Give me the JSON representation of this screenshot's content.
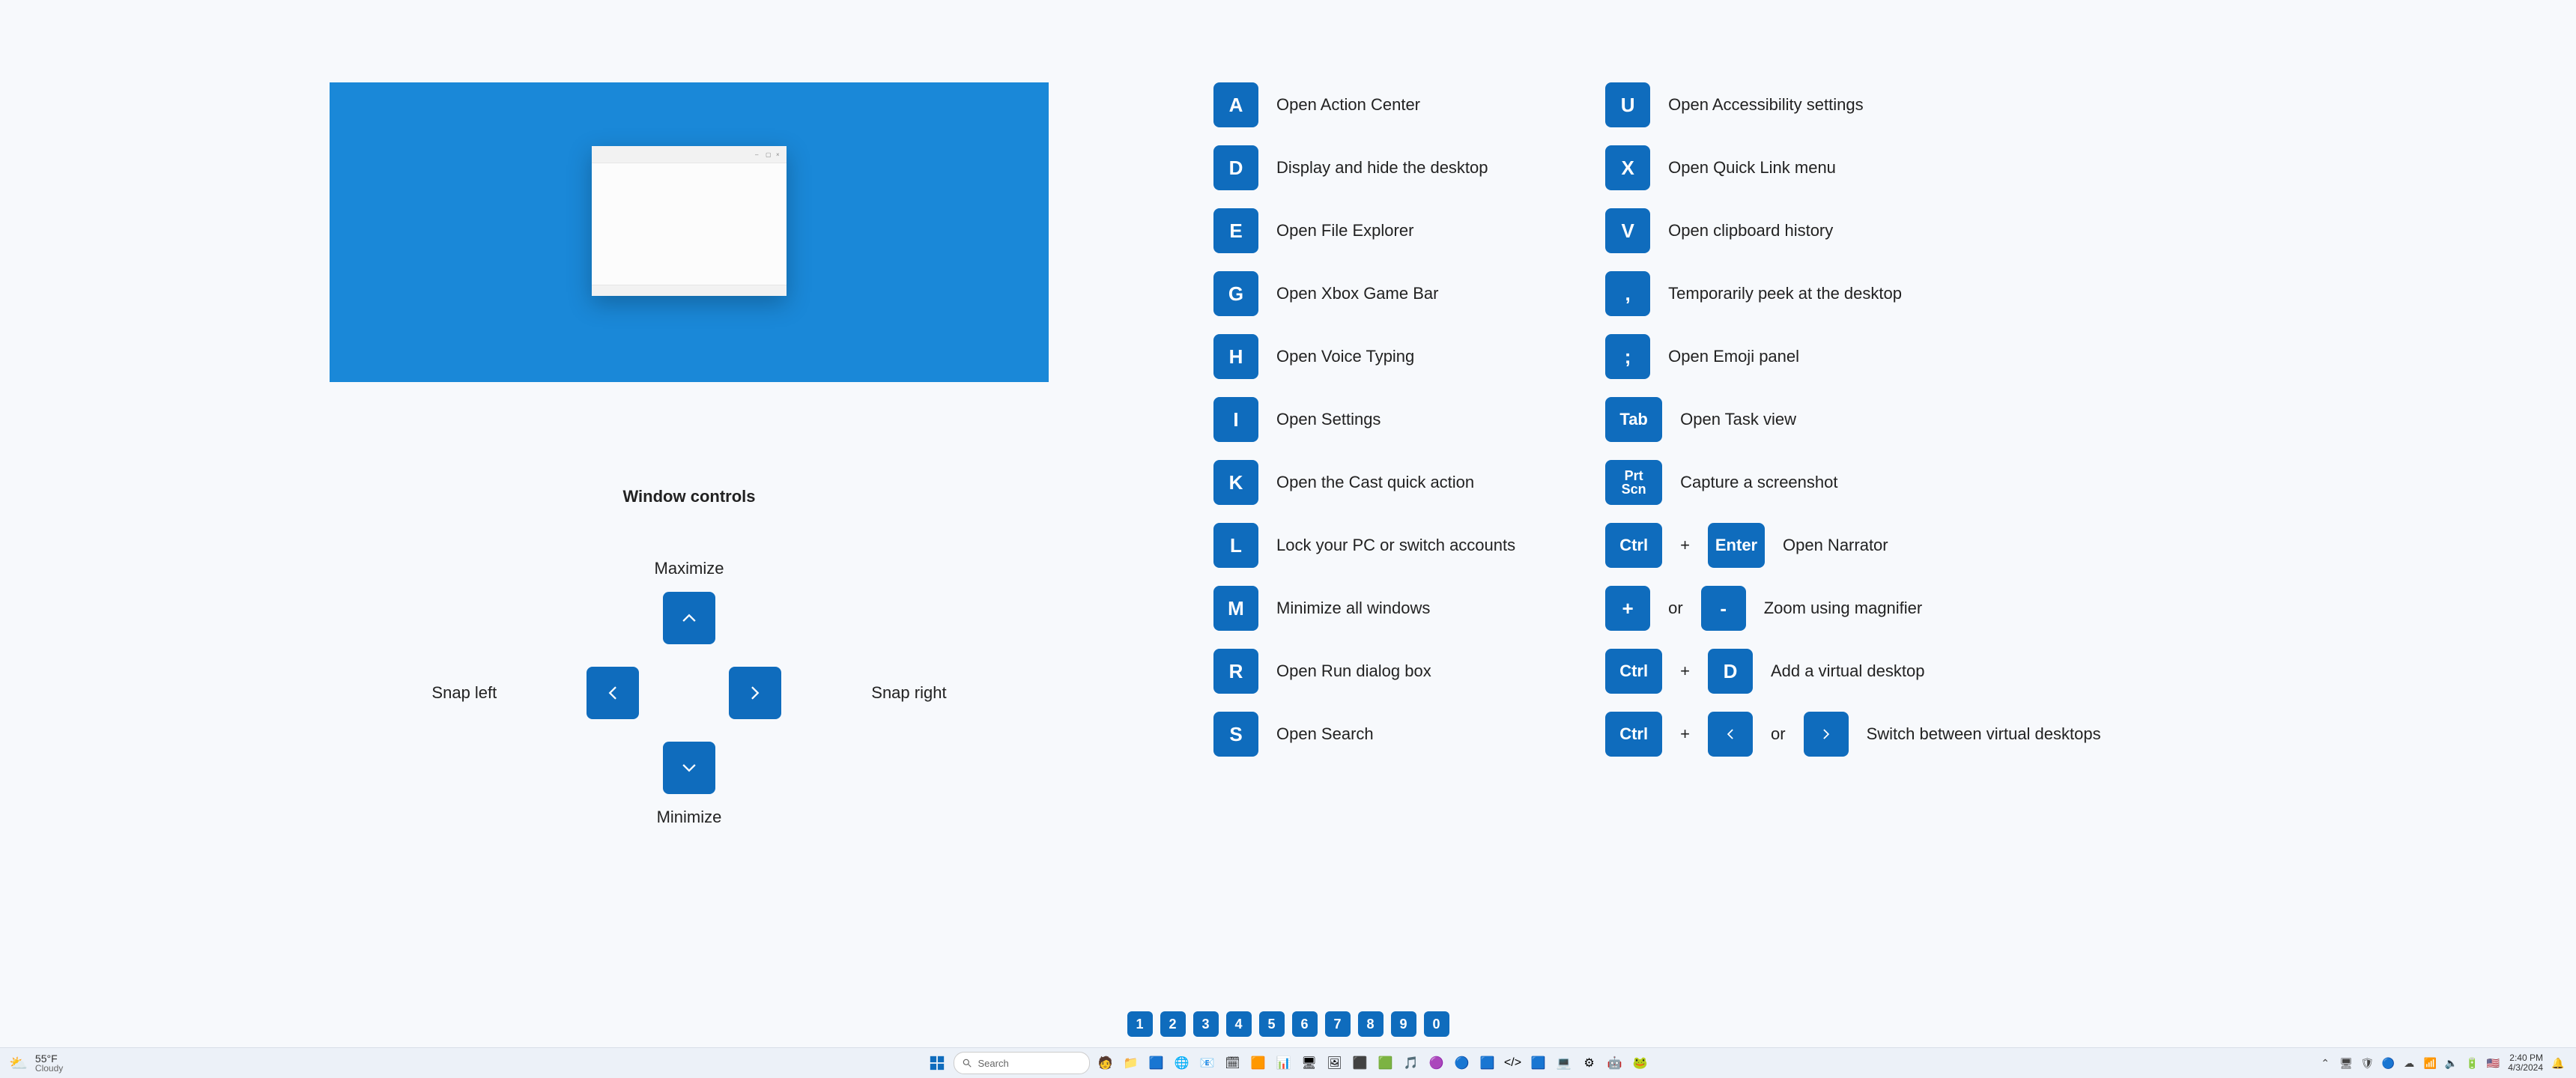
{
  "window_controls": {
    "title": "Window controls",
    "maximize": "Maximize",
    "minimize": "Minimize",
    "snap_left": "Snap left",
    "snap_right": "Snap right"
  },
  "shortcuts_left": [
    {
      "key": "A",
      "desc": "Open Action Center"
    },
    {
      "key": "D",
      "desc": "Display and hide the desktop"
    },
    {
      "key": "E",
      "desc": "Open File Explorer"
    },
    {
      "key": "G",
      "desc": "Open Xbox Game Bar"
    },
    {
      "key": "H",
      "desc": "Open Voice Typing"
    },
    {
      "key": "I",
      "desc": "Open Settings"
    },
    {
      "key": "K",
      "desc": "Open the Cast quick action"
    },
    {
      "key": "L",
      "desc": "Lock your PC or switch accounts"
    },
    {
      "key": "M",
      "desc": "Minimize all windows"
    },
    {
      "key": "R",
      "desc": "Open Run dialog box"
    },
    {
      "key": "S",
      "desc": "Open Search"
    }
  ],
  "shortcuts_right_simple": [
    {
      "key": "U",
      "desc": "Open Accessibility settings"
    },
    {
      "key": "X",
      "desc": "Open Quick Link menu"
    },
    {
      "key": "V",
      "desc": "Open clipboard history"
    },
    {
      "key": ",",
      "desc": "Temporarily peek at the desktop"
    },
    {
      "key": ";",
      "desc": "Open Emoji panel"
    }
  ],
  "shortcut_tab": {
    "key": "Tab",
    "desc": "Open Task view"
  },
  "shortcut_prtscn": {
    "key": "Prt\nScn",
    "desc": "Capture a screenshot"
  },
  "shortcut_narrator": {
    "k1": "Ctrl",
    "k2": "Enter",
    "sep": "+",
    "desc": "Open Narrator"
  },
  "shortcut_magnifier": {
    "k1": "+",
    "k2": "-",
    "sep": "or",
    "desc": "Zoom using magnifier"
  },
  "shortcut_add_desktop": {
    "k1": "Ctrl",
    "k2": "D",
    "sep": "+",
    "desc": "Add a virtual desktop"
  },
  "shortcut_switch_desktop": {
    "k1": "Ctrl",
    "sep1": "+",
    "sep2": "or",
    "desc": "Switch between virtual desktops"
  },
  "numbers": [
    "1",
    "2",
    "3",
    "4",
    "5",
    "6",
    "7",
    "8",
    "9",
    "0"
  ],
  "taskbar": {
    "weather": {
      "temp": "55°F",
      "cond": "Cloudy"
    },
    "search_placeholder": "Search",
    "apps": [
      "🧑",
      "📁",
      "🟦",
      "🌐",
      "📧",
      "🗓",
      "🟧",
      "📊",
      "🖥",
      "🖼",
      "⬛",
      "🟩",
      "🎵",
      "🟣",
      "🔵",
      "🟦",
      "</>",
      "🟦",
      "💻",
      "⚙",
      "🤖",
      "🐸"
    ],
    "tray": [
      "⌃",
      "🖥",
      "🛡",
      "🔵",
      "☁",
      "📶",
      "🔈",
      "🔋",
      "🇺🇸"
    ],
    "clock": {
      "time": "2:40 PM",
      "date": "4/3/2024"
    }
  }
}
